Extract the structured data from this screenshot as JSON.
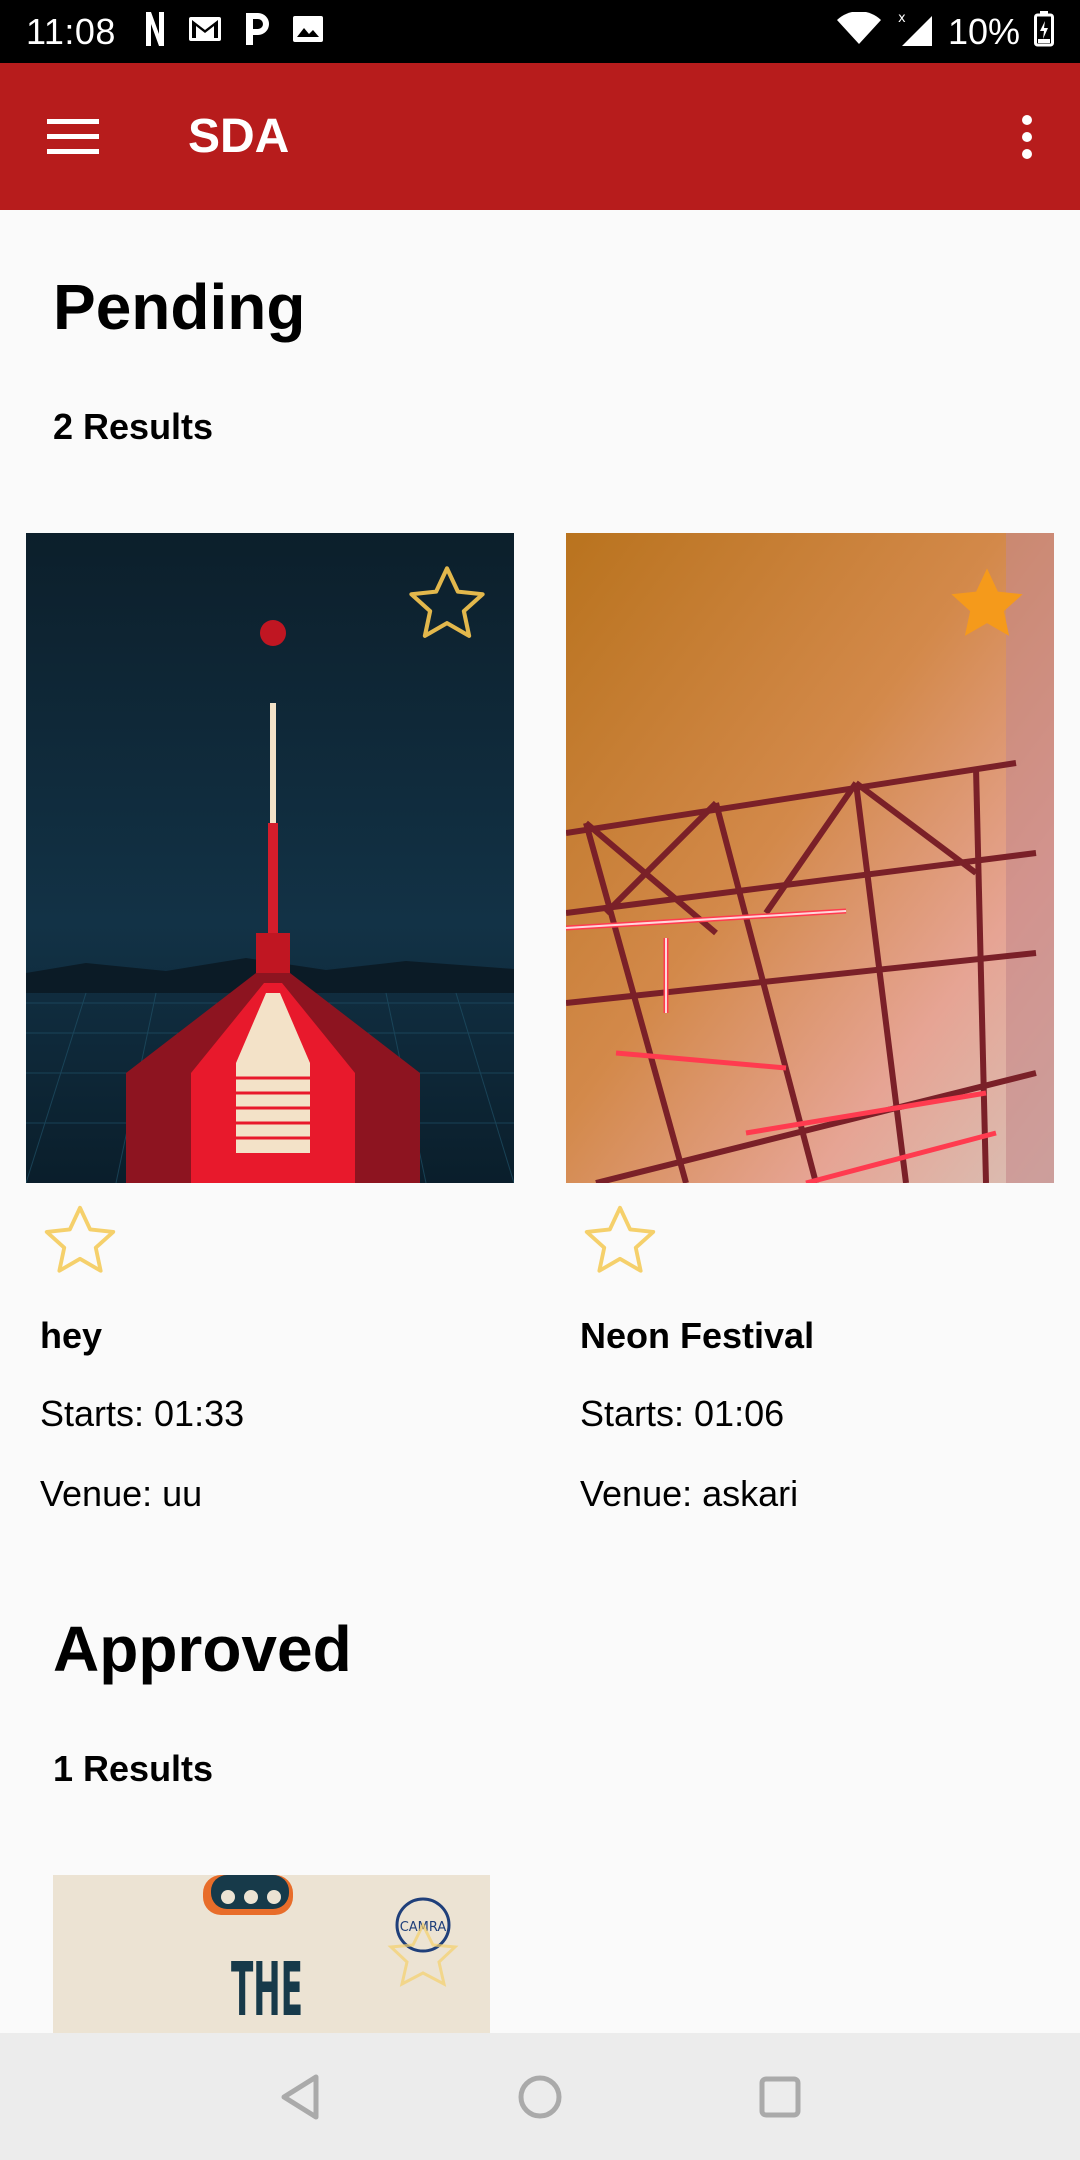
{
  "status_bar": {
    "time": "11:08",
    "battery": "10%",
    "icons": [
      "netflix-icon",
      "gmail-icon",
      "pandora-icon",
      "image-icon",
      "wifi-icon",
      "signal-icon",
      "battery-icon"
    ]
  },
  "app_bar": {
    "title": "SDA",
    "menu_icon": "hamburger-icon",
    "more_icon": "more-vert-icon",
    "color": "#b71c1c"
  },
  "pending": {
    "title": "Pending",
    "count": "2 Results",
    "events": [
      {
        "name": "hey",
        "starts": "Starts: 01:33",
        "venue": "Venue: uu",
        "favorite": false
      },
      {
        "name": "Neon Festival",
        "starts": "Starts: 01:06",
        "venue": "Venue: askari",
        "favorite": true
      }
    ]
  },
  "approved": {
    "title": "Approved",
    "count": "1 Results",
    "events": [
      {
        "image_text": "THE",
        "logo_text": "CAMRA"
      }
    ]
  },
  "nav_bar": {
    "icons": [
      "back-icon",
      "home-icon",
      "recents-icon"
    ]
  },
  "colors": {
    "star_outline": "#f5d06b",
    "star_filled": "#f59a1b",
    "background": "#fafafa"
  }
}
